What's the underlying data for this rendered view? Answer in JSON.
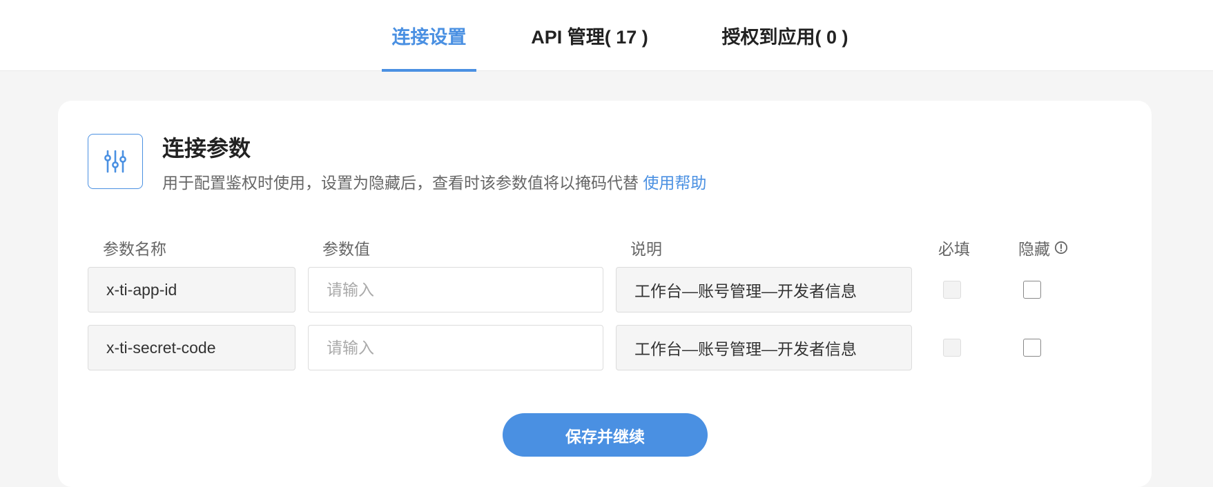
{
  "tabs": [
    {
      "label": "连接设置",
      "active": true
    },
    {
      "label": "API 管理( 17 )",
      "active": false
    },
    {
      "label": "授权到应用( 0 )",
      "active": false
    }
  ],
  "section": {
    "icon": "sliders-icon",
    "title": "连接参数",
    "description": "用于配置鉴权时使用，设置为隐藏后，查看时该参数值将以掩码代替",
    "help_link": "使用帮助"
  },
  "table": {
    "headers": {
      "name": "参数名称",
      "value": "参数值",
      "description": "说明",
      "required": "必填",
      "hidden": "隐藏"
    },
    "rows": [
      {
        "name": "x-ti-app-id",
        "value_placeholder": "请输入",
        "value": "",
        "description": "工作台—账号管理—开发者信息",
        "required": false,
        "hidden": false
      },
      {
        "name": "x-ti-secret-code",
        "value_placeholder": "请输入",
        "value": "",
        "description": "工作台—账号管理—开发者信息",
        "required": false,
        "hidden": false
      }
    ]
  },
  "actions": {
    "save_label": "保存并继续"
  },
  "colors": {
    "accent": "#4a90e2",
    "background": "#f5f5f5"
  }
}
